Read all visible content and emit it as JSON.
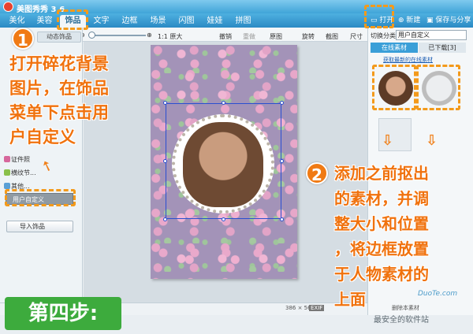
{
  "app": {
    "title": "美图秀秀 3.6",
    "brand_color": "#3fa4d8"
  },
  "tabs": [
    {
      "label": "美化"
    },
    {
      "label": "美容"
    },
    {
      "label": "饰品"
    },
    {
      "label": "文字"
    },
    {
      "label": "边框"
    },
    {
      "label": "场景"
    },
    {
      "label": "闪图"
    },
    {
      "label": "娃娃"
    },
    {
      "label": "拼图"
    }
  ],
  "header_actions": {
    "open": "打开",
    "new": "新建",
    "save": "保存与分享"
  },
  "toolbar": {
    "original_size": "1:1 原大",
    "undo": "撤销",
    "redo": "重做",
    "original": "原图",
    "rotate": "旋转",
    "crop": "截图",
    "resize": "尺寸"
  },
  "left_panel": {
    "dynamic_tab": "动态饰品",
    "categories": [
      {
        "label": "证件照"
      },
      {
        "label": "横纹节..."
      },
      {
        "label": "其他..."
      },
      {
        "label": "用户自定义"
      }
    ],
    "import_button": "导入饰品"
  },
  "right_panel": {
    "category_label": "切换分类",
    "category_value": "用户自定义",
    "tab_online": "在线素材",
    "tab_downloaded": "已下载[3]",
    "link_latest": "获取最新的在线素材",
    "delete_label": "删除本素材"
  },
  "status": {
    "dimensions": "386 × 567",
    "exif": "EXIF"
  },
  "overlay": {
    "step1_number": "1",
    "step1_text": [
      "打开碎花背景",
      "图片，在饰品",
      "菜单下点击用",
      "户自定义"
    ],
    "step2_number": "2",
    "step2_text": [
      "添加之前抠出",
      "的素材，并调",
      "整大小和位置",
      "，将边框放置",
      "于人物素材的",
      "上面"
    ],
    "step_label": "第四步:",
    "accent_color": "#f0720e",
    "step_color": "#3dab3d"
  },
  "watermark": {
    "text": "最安全的软件站",
    "brand": "DuoTe.com"
  }
}
